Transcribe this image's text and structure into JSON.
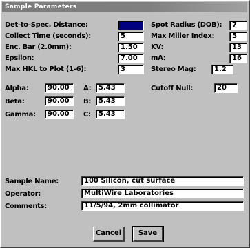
{
  "window": {
    "title": "Sample Parameters"
  },
  "fields": {
    "det_to_spec_distance": {
      "label": "Det-to-Spec. Distance:",
      "value": ""
    },
    "collect_time": {
      "label": "Collect Time (seconds):",
      "value": "5"
    },
    "enc_bar": {
      "label": "Enc. Bar (2.0mm):",
      "value": "1.50"
    },
    "epsilon": {
      "label": "Epsilon:",
      "value": "7.00"
    },
    "max_hkl": {
      "label": "Max HKL to Plot (1-6):",
      "value": "3"
    },
    "spot_radius": {
      "label": "Spot Radius (DOB):",
      "value": "7"
    },
    "max_miller": {
      "label": "Max Miller Index:",
      "value": "5"
    },
    "kv": {
      "label": "KV:",
      "value": "13"
    },
    "ma": {
      "label": "mA:",
      "value": "16"
    },
    "stereo_mag": {
      "label": "Stereo Mag:",
      "value": "1.2"
    },
    "cutoff_null": {
      "label": "Cutoff Null:",
      "value": "20"
    },
    "alpha": {
      "label": "Alpha:",
      "value": "90.00"
    },
    "beta": {
      "label": "Beta:",
      "value": "90.00"
    },
    "gamma": {
      "label": "Gamma:",
      "value": "90.00"
    },
    "a": {
      "label": "A:",
      "value": "5.43"
    },
    "b": {
      "label": "B:",
      "value": "5.43"
    },
    "c": {
      "label": "C:",
      "value": "5.43"
    },
    "sample_name": {
      "label": "Sample Name:",
      "value": "100 Silicon, cut surface"
    },
    "operator": {
      "label": "Operator:",
      "value": "MultiWire Laboratories"
    },
    "comments": {
      "label": "Comments:",
      "value": "11/5/94, 2mm collimator"
    }
  },
  "buttons": {
    "cancel": "Cancel",
    "save": "Save"
  }
}
